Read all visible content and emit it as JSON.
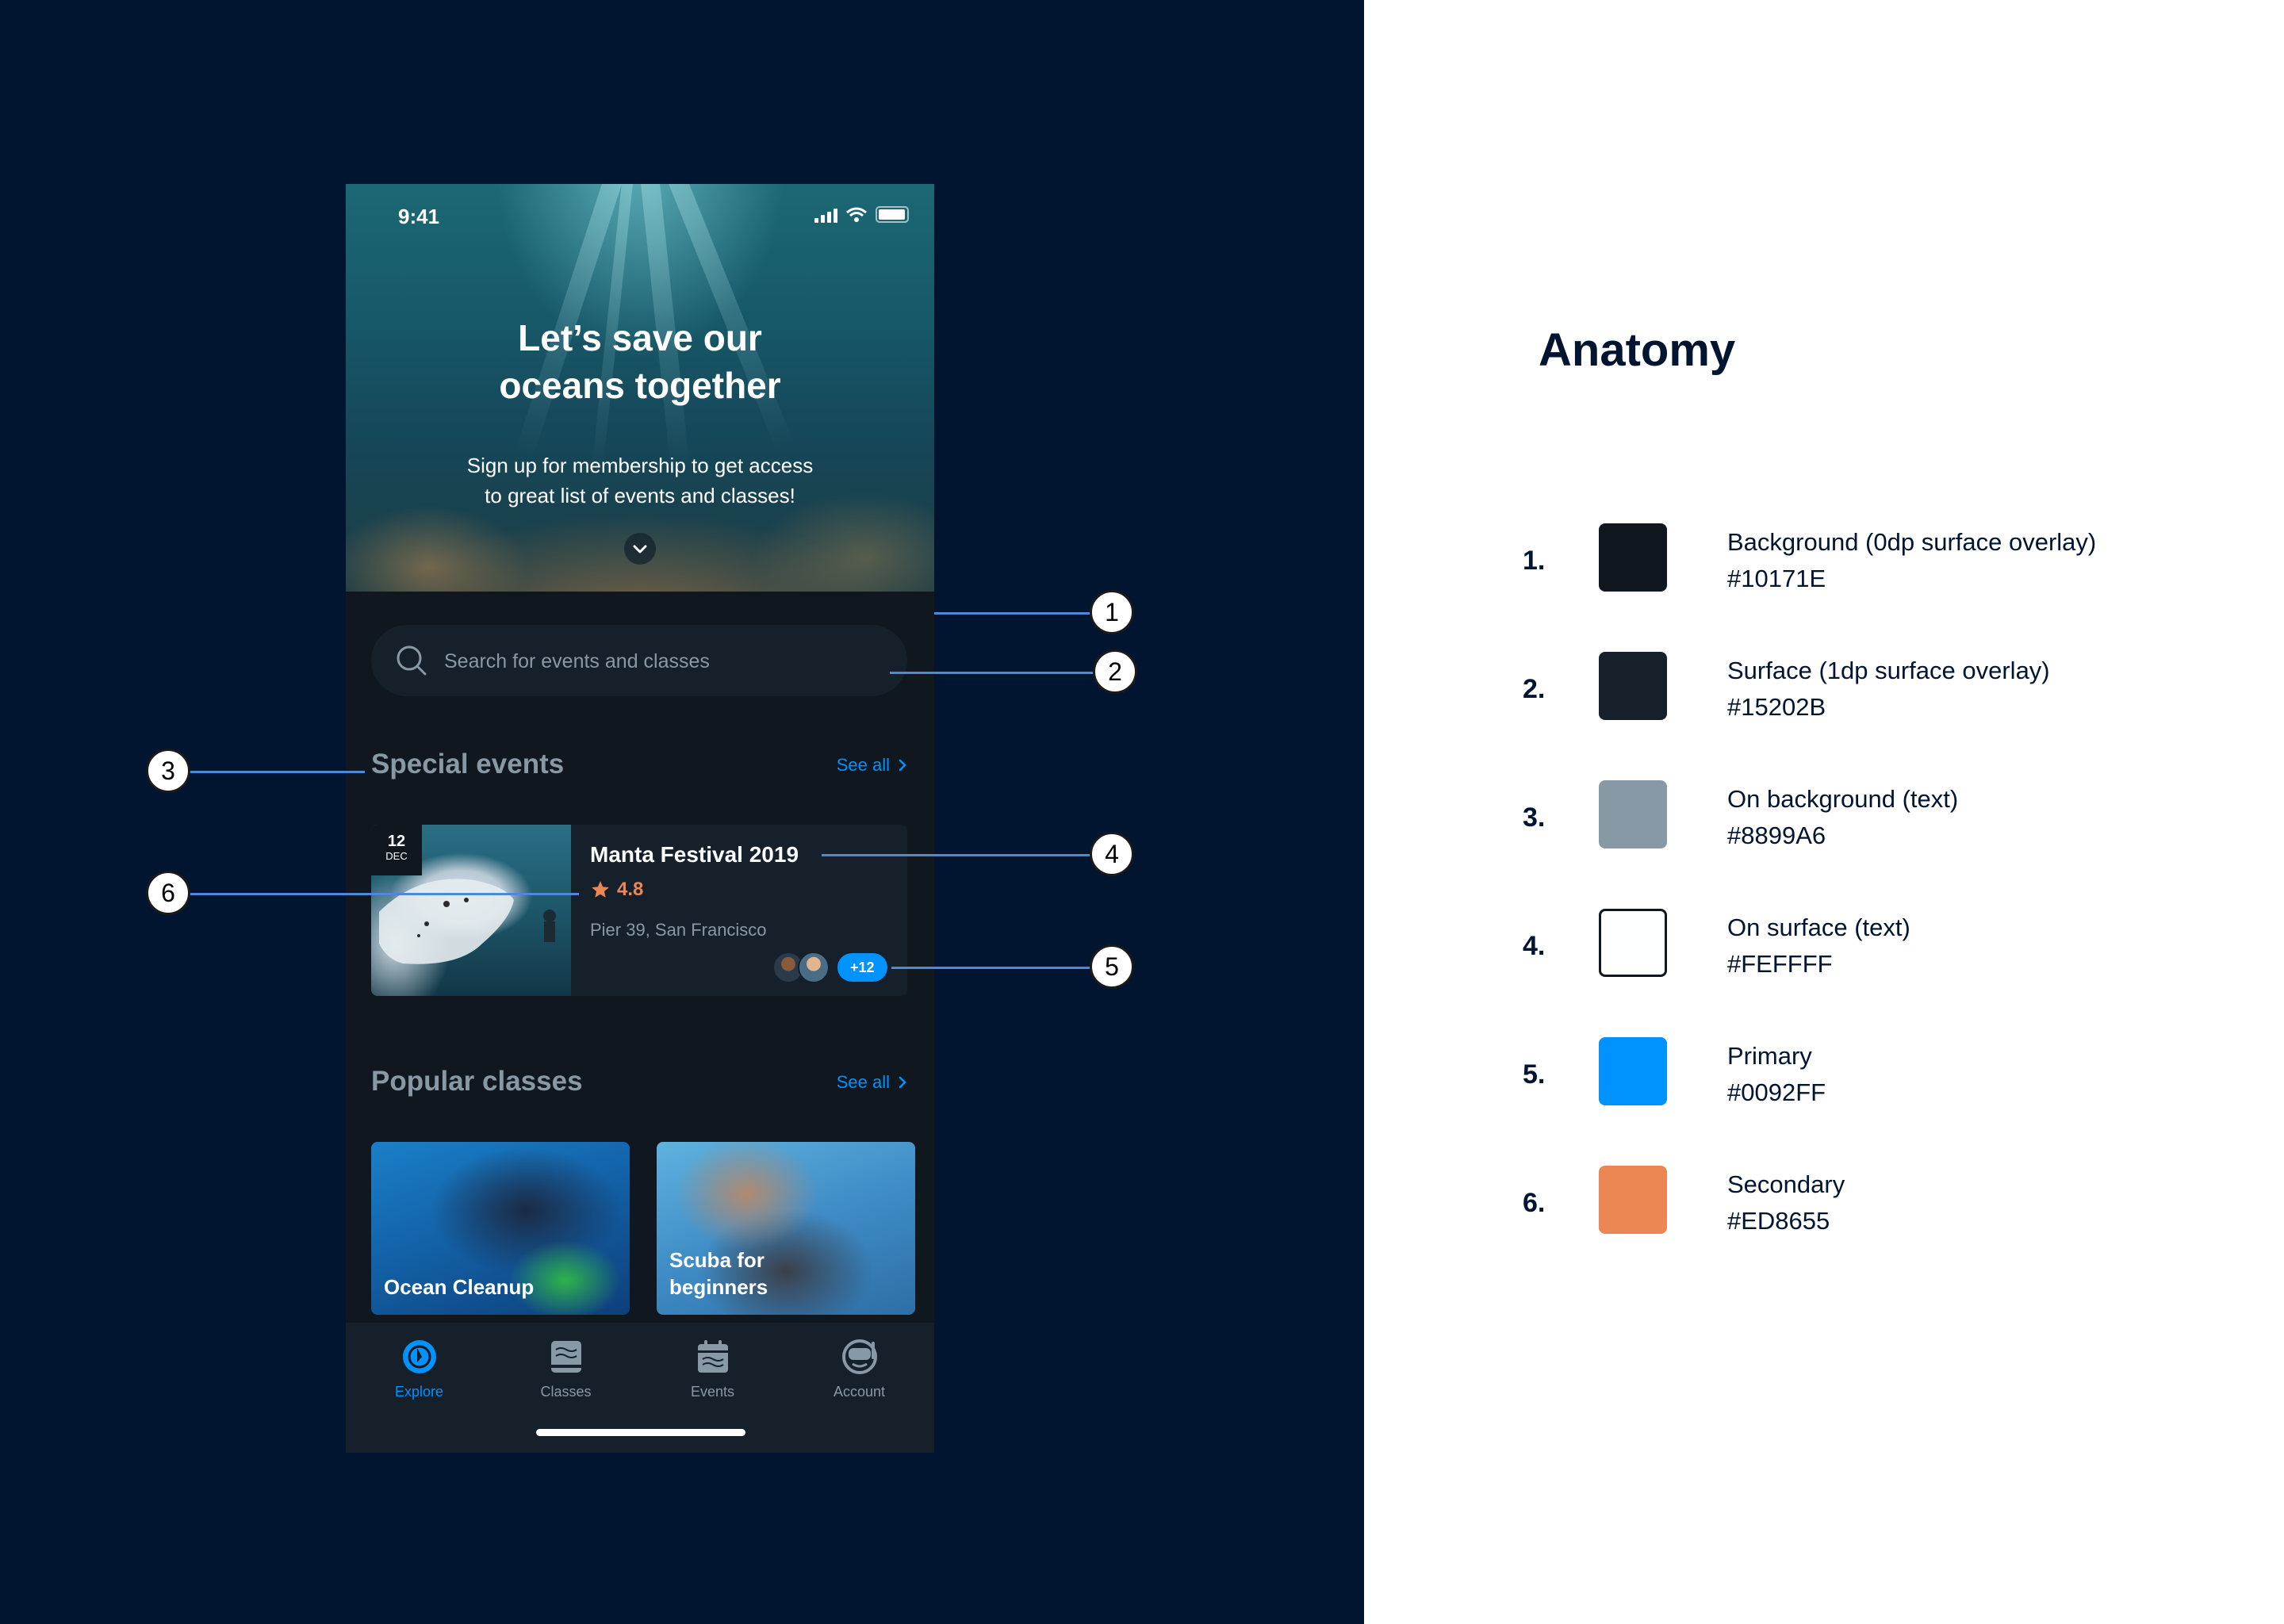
{
  "phone": {
    "status_time": "9:41",
    "hero_title_line1": "Let’s save our",
    "hero_title_line2": "oceans together",
    "hero_subtitle_line1": "Sign up for membership to get access",
    "hero_subtitle_line2": "to great list of events and classes!",
    "search_placeholder": "Search for events and classes",
    "special_events": {
      "title": "Special events",
      "see_all": "See all",
      "card": {
        "date_day": "12",
        "date_month": "DEC",
        "title": "Manta Festival 2019",
        "rating": "4.8",
        "location": "Pier 39, San Francisco",
        "more_count": "+12"
      }
    },
    "popular_classes": {
      "title": "Popular classes",
      "see_all": "See all",
      "items": [
        {
          "label": "Ocean Cleanup"
        },
        {
          "label": "Scuba for beginners"
        }
      ]
    },
    "tabs": [
      {
        "label": "Explore",
        "icon": "compass-icon",
        "active": true
      },
      {
        "label": "Classes",
        "icon": "book-icon",
        "active": false
      },
      {
        "label": "Events",
        "icon": "calendar-icon",
        "active": false
      },
      {
        "label": "Account",
        "icon": "diving-mask-icon",
        "active": false
      }
    ]
  },
  "callouts": [
    "1",
    "2",
    "3",
    "4",
    "5",
    "6"
  ],
  "anatomy": {
    "title": "Anatomy",
    "items": [
      {
        "num": "1.",
        "name": "Background (0dp surface overlay)",
        "hex": "#10171E",
        "color": "#10171E"
      },
      {
        "num": "2.",
        "name": "Surface (1dp surface overlay)",
        "hex": "#15202B",
        "color": "#15202B"
      },
      {
        "num": "3.",
        "name": "On background (text)",
        "hex": "#8899A6",
        "color": "#8899A6"
      },
      {
        "num": "4.",
        "name": "On surface (text)",
        "hex": "#FEFFFF",
        "color": "#FEFFFF"
      },
      {
        "num": "5.",
        "name": "Primary",
        "hex": "#0092FF",
        "color": "#0092FF"
      },
      {
        "num": "6.",
        "name": "Secondary",
        "hex": "#ED8655",
        "color": "#ED8655"
      }
    ]
  },
  "colors": {
    "page_background": "#021530",
    "accent_line": "#4d89d8"
  }
}
